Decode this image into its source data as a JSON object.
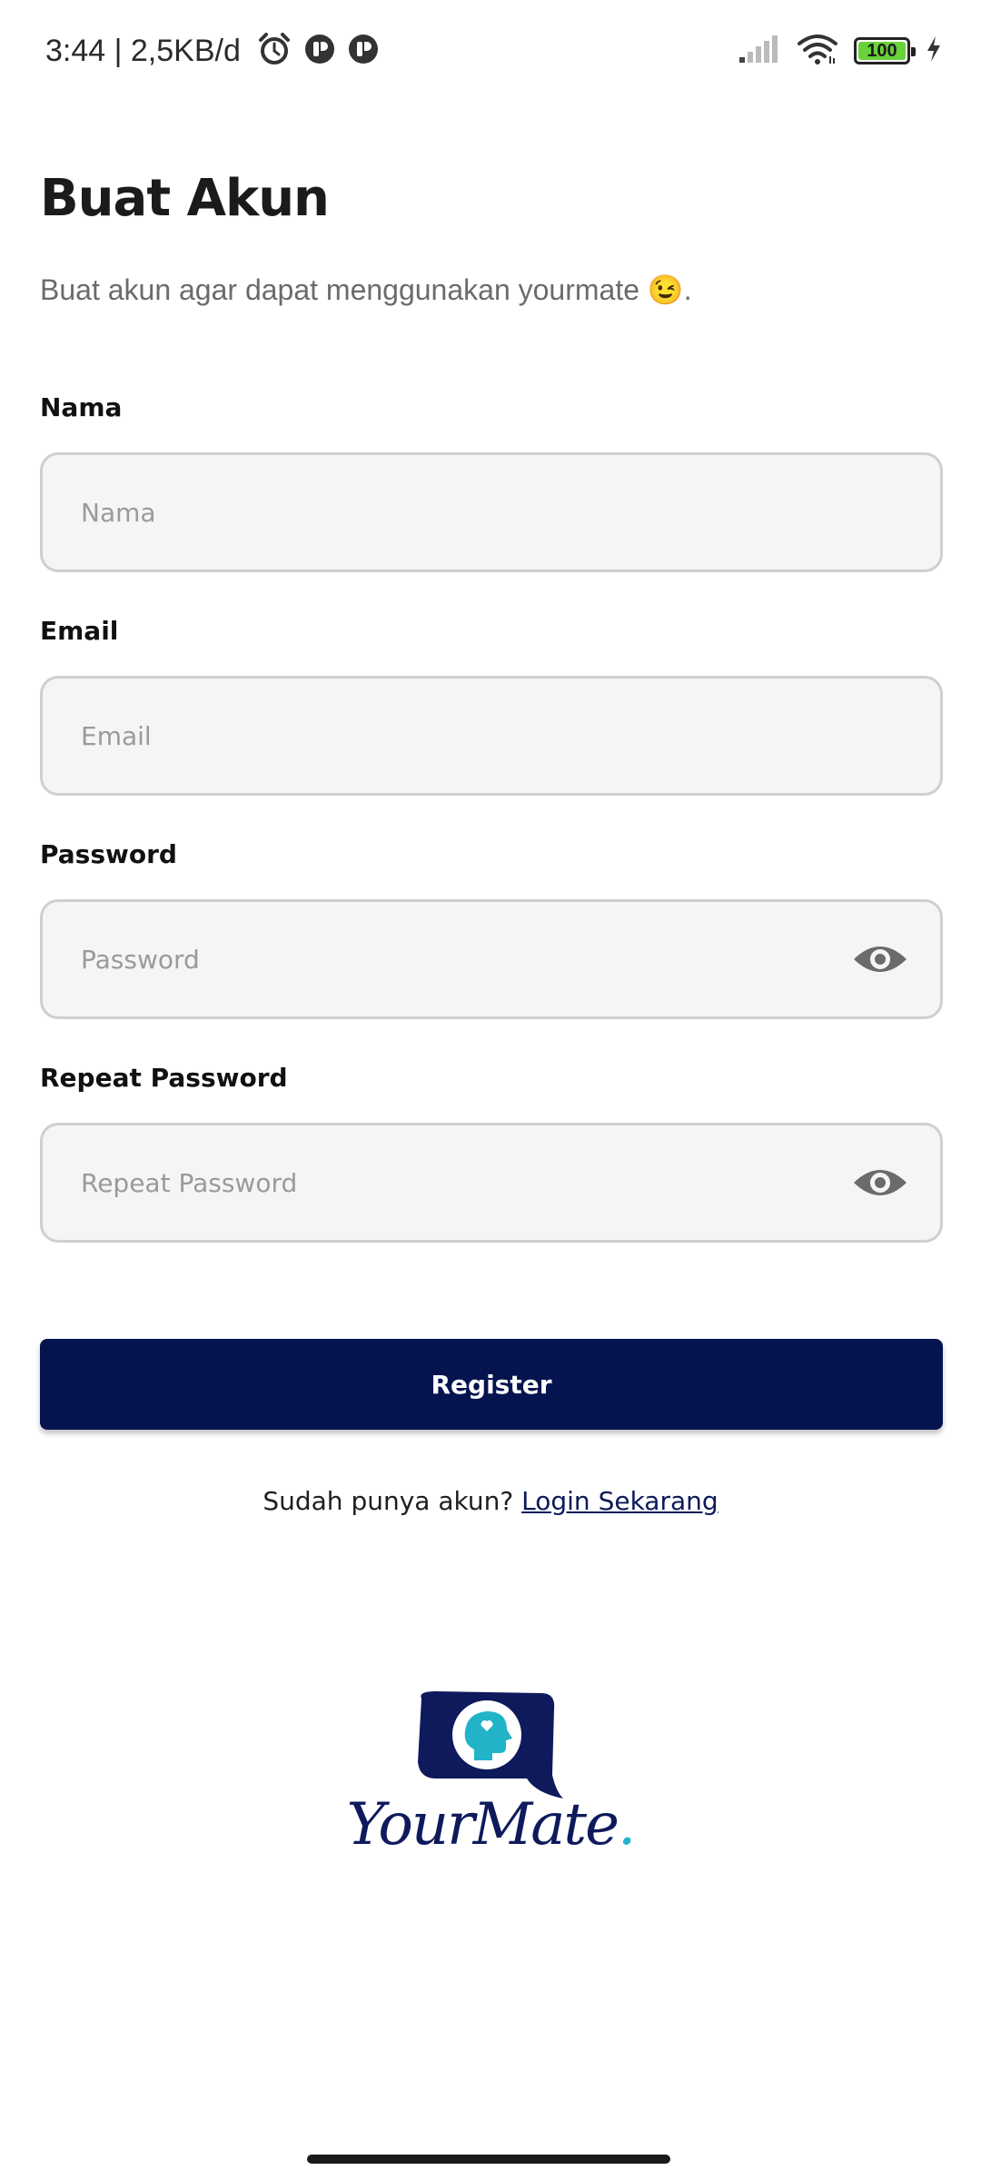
{
  "status_bar": {
    "time_speed": "3:44 | 2,5KB/d",
    "battery": "100"
  },
  "header": {
    "title": "Buat Akun",
    "subtitle": "Buat akun agar dapat menggunakan yourmate 😉."
  },
  "form": {
    "name_label": "Nama",
    "name_placeholder": "Nama",
    "email_label": "Email",
    "email_placeholder": "Email",
    "password_label": "Password",
    "password_placeholder": "Password",
    "repeat_label": "Repeat Password",
    "repeat_placeholder": "Repeat Password"
  },
  "actions": {
    "register_label": "Register",
    "login_prompt": "Sudah punya akun?",
    "login_link": "Login Sekarang"
  },
  "logo": {
    "text": "YourMate",
    "dot": "."
  },
  "colors": {
    "primary": "#05144F",
    "accent": "#22B3C9",
    "field_bg": "#F5F5F5",
    "field_border": "#CFCFCF"
  },
  "icons": [
    "alarm-icon",
    "notification-icon",
    "signal-icon",
    "wifi-icon",
    "battery-icon",
    "charging-icon",
    "eye-icon"
  ]
}
